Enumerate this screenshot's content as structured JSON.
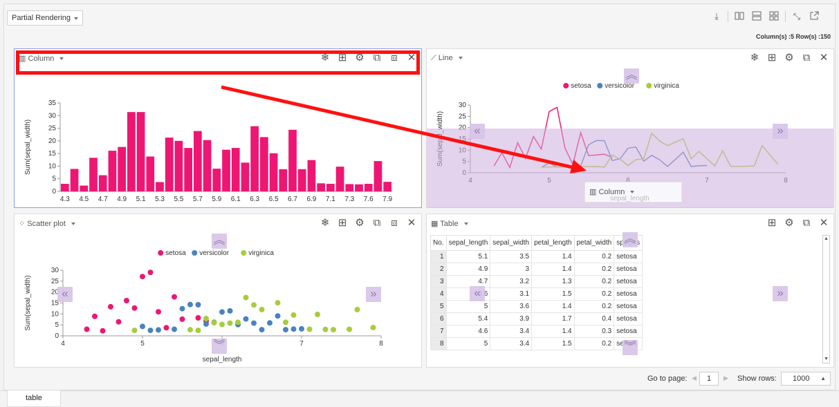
{
  "toolbar": {
    "mode_select": "Partial Rendering",
    "counts": "Column(s) :5  Row(s) :150"
  },
  "panels": {
    "column": {
      "title": "Column"
    },
    "line": {
      "title": "Line"
    },
    "scatter": {
      "title": "Scatter plot"
    },
    "table": {
      "title": "Table"
    }
  },
  "drag_ghost": {
    "title": "Column",
    "sub": "sepal_length"
  },
  "legend": [
    {
      "name": "setosa",
      "color": "#ee1673"
    },
    {
      "name": "versicolor",
      "color": "#4a82bf"
    },
    {
      "name": "virginica",
      "color": "#a8cc3a"
    }
  ],
  "chart_data": [
    {
      "type": "bar",
      "xlabel": "sepal_length",
      "ylabel": "Sum(sepal_width)",
      "ylim": [
        0,
        35
      ],
      "yticks": [
        0,
        5,
        10,
        15,
        20,
        25,
        30,
        35
      ],
      "categories": [
        "4.3",
        "4.4",
        "4.5",
        "4.6",
        "4.7",
        "4.8",
        "4.9",
        "5",
        "5.1",
        "5.2",
        "5.3",
        "5.4",
        "5.5",
        "5.6",
        "5.7",
        "5.8",
        "5.9",
        "6",
        "6.1",
        "6.2",
        "6.3",
        "6.4",
        "6.5",
        "6.6",
        "6.7",
        "6.8",
        "6.9",
        "7",
        "7.1",
        "7.2",
        "7.3",
        "7.4",
        "7.6",
        "7.7",
        "7.9"
      ],
      "xtick_labels": [
        "4.3",
        "4.5",
        "4.7",
        "4.9",
        "5.1",
        "5.3",
        "5.5",
        "5.7",
        "5.9",
        "6.1",
        "6.3",
        "6.5",
        "6.7",
        "6.9",
        "7.1",
        "7.3",
        "7.6",
        "7.9"
      ],
      "values": [
        3.0,
        8.9,
        2.3,
        13.3,
        6.4,
        16.1,
        17.6,
        31.4,
        31.4,
        13.8,
        3.7,
        21.3,
        20.0,
        17.2,
        23.9,
        20.3,
        9.0,
        16.5,
        17.2,
        11.4,
        25.8,
        21.5,
        15.1,
        8.8,
        24.4,
        8.8,
        12.4,
        3.2,
        3.0,
        9.8,
        2.9,
        2.8,
        3.0,
        12.0,
        3.8
      ],
      "color": "#ee1673"
    },
    {
      "type": "line",
      "xlabel": "sepal_length",
      "ylabel": "Sum(sepal_width)",
      "xlim": [
        4,
        8
      ],
      "ylim": [
        0,
        30
      ],
      "yticks": [
        0,
        5,
        10,
        15,
        20,
        25,
        30
      ],
      "xticks": [
        4,
        5,
        6,
        7,
        8
      ],
      "series": [
        {
          "name": "setosa",
          "color": "#ee1673",
          "points": [
            [
              4.3,
              3.0
            ],
            [
              4.4,
              8.9
            ],
            [
              4.5,
              2.3
            ],
            [
              4.6,
              13.3
            ],
            [
              4.7,
              6.4
            ],
            [
              4.8,
              16.1
            ],
            [
              4.9,
              10.5
            ],
            [
              5.0,
              27.1
            ],
            [
              5.1,
              29.0
            ],
            [
              5.2,
              11.0
            ],
            [
              5.3,
              3.7
            ],
            [
              5.4,
              17.8
            ],
            [
              5.5,
              7.6
            ],
            [
              5.7,
              8.2
            ],
            [
              5.8,
              6.7
            ]
          ]
        },
        {
          "name": "versicolor",
          "color": "#4a82bf",
          "points": [
            [
              4.9,
              2.4
            ],
            [
              5.0,
              4.3
            ],
            [
              5.1,
              2.5
            ],
            [
              5.2,
              2.7
            ],
            [
              5.4,
              3.0
            ],
            [
              5.5,
              12.4
            ],
            [
              5.6,
              14.3
            ],
            [
              5.7,
              14.2
            ],
            [
              5.8,
              5.4
            ],
            [
              5.9,
              6.2
            ],
            [
              6.0,
              10.9
            ],
            [
              6.1,
              11.4
            ],
            [
              6.2,
              5.1
            ],
            [
              6.3,
              7.7
            ],
            [
              6.4,
              5.8
            ],
            [
              6.5,
              2.8
            ],
            [
              6.6,
              5.9
            ],
            [
              6.7,
              9.1
            ],
            [
              6.8,
              2.8
            ],
            [
              6.9,
              3.1
            ],
            [
              7.0,
              3.2
            ]
          ]
        },
        {
          "name": "virginica",
          "color": "#a8cc3a",
          "points": [
            [
              4.9,
              2.5
            ],
            [
              5.6,
              2.8
            ],
            [
              5.7,
              2.5
            ],
            [
              5.8,
              7.9
            ],
            [
              5.9,
              6.0
            ],
            [
              6.0,
              3.2
            ],
            [
              6.1,
              5.8
            ],
            [
              6.2,
              6.2
            ],
            [
              6.3,
              17.5
            ],
            [
              6.4,
              14.1
            ],
            [
              6.5,
              12.0
            ],
            [
              6.7,
              15.1
            ],
            [
              6.8,
              6.2
            ],
            [
              6.9,
              9.5
            ],
            [
              7.1,
              3.0
            ],
            [
              7.2,
              9.8
            ],
            [
              7.3,
              2.9
            ],
            [
              7.4,
              2.8
            ],
            [
              7.6,
              3.0
            ],
            [
              7.7,
              12.0
            ],
            [
              7.9,
              3.8
            ]
          ]
        }
      ]
    },
    {
      "type": "scatter",
      "xlabel": "sepal_length",
      "ylabel": "Sum(sepal_width)",
      "xlim": [
        4,
        8
      ],
      "ylim": [
        0,
        30
      ],
      "yticks": [
        0,
        5,
        10,
        15,
        20,
        25,
        30
      ],
      "xticks": [
        4,
        5,
        6,
        7,
        8
      ],
      "series": [
        {
          "name": "setosa",
          "color": "#ee1673",
          "points": [
            [
              4.3,
              3.0
            ],
            [
              4.4,
              8.9
            ],
            [
              4.5,
              2.3
            ],
            [
              4.6,
              13.3
            ],
            [
              4.7,
              6.4
            ],
            [
              4.8,
              16.1
            ],
            [
              4.9,
              12.7
            ],
            [
              5.0,
              27.1
            ],
            [
              5.1,
              29.0
            ],
            [
              5.2,
              11.0
            ],
            [
              5.3,
              3.7
            ],
            [
              5.4,
              17.8
            ],
            [
              5.5,
              7.6
            ],
            [
              5.7,
              8.2
            ],
            [
              5.8,
              6.7
            ]
          ]
        },
        {
          "name": "versicolor",
          "color": "#4a82bf",
          "points": [
            [
              5.0,
              4.3
            ],
            [
              5.1,
              2.5
            ],
            [
              5.2,
              2.7
            ],
            [
              5.4,
              3.0
            ],
            [
              5.5,
              12.4
            ],
            [
              5.6,
              14.3
            ],
            [
              5.7,
              14.2
            ],
            [
              5.8,
              5.4
            ],
            [
              5.9,
              6.2
            ],
            [
              6.0,
              10.9
            ],
            [
              6.1,
              11.4
            ],
            [
              6.2,
              5.1
            ],
            [
              6.3,
              7.7
            ],
            [
              6.4,
              5.8
            ],
            [
              6.5,
              2.8
            ],
            [
              6.6,
              5.9
            ],
            [
              6.7,
              9.1
            ],
            [
              6.8,
              2.8
            ],
            [
              6.9,
              3.1
            ],
            [
              7.0,
              3.2
            ]
          ]
        },
        {
          "name": "virginica",
          "color": "#a8cc3a",
          "points": [
            [
              4.9,
              2.5
            ],
            [
              5.6,
              2.8
            ],
            [
              5.7,
              2.5
            ],
            [
              5.8,
              7.9
            ],
            [
              5.9,
              6.0
            ],
            [
              6.0,
              5.2
            ],
            [
              6.1,
              5.8
            ],
            [
              6.2,
              6.2
            ],
            [
              6.3,
              17.5
            ],
            [
              6.4,
              14.1
            ],
            [
              6.5,
              12.0
            ],
            [
              6.7,
              15.1
            ],
            [
              6.8,
              6.2
            ],
            [
              6.9,
              9.5
            ],
            [
              7.2,
              9.8
            ],
            [
              7.1,
              3.0
            ],
            [
              7.3,
              2.9
            ],
            [
              7.4,
              2.8
            ],
            [
              7.6,
              3.0
            ],
            [
              7.7,
              12.0
            ],
            [
              7.9,
              3.8
            ]
          ]
        }
      ]
    },
    {
      "type": "table",
      "columns": [
        "No.",
        "sepal_length",
        "sepal_width",
        "petal_length",
        "petal_width",
        "species"
      ],
      "rows": [
        [
          "1",
          "5.1",
          "3.5",
          "1.4",
          "0.2",
          "setosa"
        ],
        [
          "2",
          "4.9",
          "3",
          "1.4",
          "0.2",
          "setosa"
        ],
        [
          "3",
          "4.7",
          "3.2",
          "1.3",
          "0.2",
          "setosa"
        ],
        [
          "4",
          "4.6",
          "3.1",
          "1.5",
          "0.2",
          "setosa"
        ],
        [
          "5",
          "5",
          "3.6",
          "1.4",
          "0.2",
          "setosa"
        ],
        [
          "6",
          "5.4",
          "3.9",
          "1.7",
          "0.4",
          "setosa"
        ],
        [
          "7",
          "4.6",
          "3.4",
          "1.4",
          "0.3",
          "setosa"
        ],
        [
          "8",
          "5",
          "3.4",
          "1.5",
          "0.2",
          "setosa"
        ]
      ]
    }
  ],
  "pagination": {
    "goto_label": "Go to page:",
    "page": "1",
    "rows_label": "Show rows:",
    "rows_value": "1000"
  },
  "tabs": [
    {
      "label": "table"
    }
  ]
}
